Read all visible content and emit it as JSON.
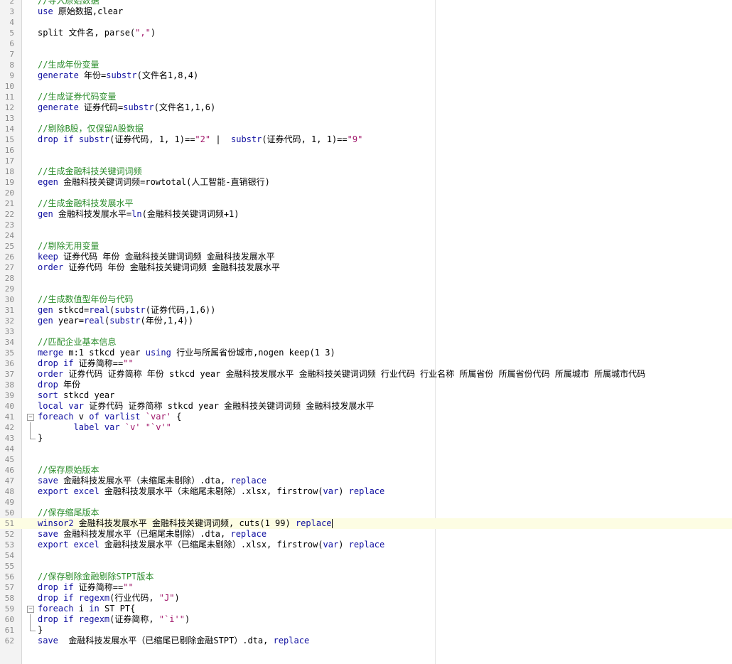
{
  "editor": {
    "language": "stata-do",
    "current_line": 51,
    "colors": {
      "keyword": "#1010a0",
      "comment": "#2a8c2a",
      "string": "#a0176a",
      "text": "#000000",
      "current_line_bg": "#fdfde3"
    },
    "lines": [
      {
        "n": "2",
        "tokens": [
          {
            "t": "c",
            "v": "//导入原始数据"
          }
        ]
      },
      {
        "n": "3",
        "tokens": [
          {
            "t": "k",
            "v": "use"
          },
          {
            "t": "p",
            "v": " 原始数据,clear"
          }
        ]
      },
      {
        "n": "4",
        "tokens": []
      },
      {
        "n": "5",
        "tokens": [
          {
            "t": "p",
            "v": "split 文件名, parse("
          },
          {
            "t": "s",
            "v": "\",\""
          },
          {
            "t": "p",
            "v": ")"
          }
        ]
      },
      {
        "n": "6",
        "tokens": []
      },
      {
        "n": "7",
        "tokens": []
      },
      {
        "n": "8",
        "tokens": [
          {
            "t": "c",
            "v": "//生成年份变量"
          }
        ]
      },
      {
        "n": "9",
        "tokens": [
          {
            "t": "k",
            "v": "generate"
          },
          {
            "t": "p",
            "v": " 年份="
          },
          {
            "t": "k",
            "v": "substr"
          },
          {
            "t": "p",
            "v": "(文件名1,8,4)"
          }
        ]
      },
      {
        "n": "10",
        "tokens": []
      },
      {
        "n": "11",
        "tokens": [
          {
            "t": "c",
            "v": "//生成证券代码变量"
          }
        ]
      },
      {
        "n": "12",
        "tokens": [
          {
            "t": "k",
            "v": "generate"
          },
          {
            "t": "p",
            "v": " 证券代码="
          },
          {
            "t": "k",
            "v": "substr"
          },
          {
            "t": "p",
            "v": "(文件名1,1,6)"
          }
        ]
      },
      {
        "n": "13",
        "tokens": []
      },
      {
        "n": "14",
        "tokens": [
          {
            "t": "c",
            "v": "//剔除B股，仅保留A股数据"
          }
        ]
      },
      {
        "n": "15",
        "tokens": [
          {
            "t": "k",
            "v": "drop if"
          },
          {
            "t": "p",
            "v": " "
          },
          {
            "t": "k",
            "v": "substr"
          },
          {
            "t": "p",
            "v": "(证券代码, 1, 1)=="
          },
          {
            "t": "s",
            "v": "\"2\""
          },
          {
            "t": "p",
            "v": " |  "
          },
          {
            "t": "k",
            "v": "substr"
          },
          {
            "t": "p",
            "v": "(证券代码, 1, 1)=="
          },
          {
            "t": "s",
            "v": "\"9\""
          }
        ]
      },
      {
        "n": "16",
        "tokens": []
      },
      {
        "n": "17",
        "tokens": []
      },
      {
        "n": "18",
        "tokens": [
          {
            "t": "c",
            "v": "//生成金融科技关键词词频"
          }
        ]
      },
      {
        "n": "19",
        "tokens": [
          {
            "t": "k",
            "v": "egen"
          },
          {
            "t": "p",
            "v": " 金融科技关键词词频=rowtotal(人工智能-直销银行)"
          }
        ]
      },
      {
        "n": "20",
        "tokens": []
      },
      {
        "n": "21",
        "tokens": [
          {
            "t": "c",
            "v": "//生成金融科技发展水平"
          }
        ]
      },
      {
        "n": "22",
        "tokens": [
          {
            "t": "k",
            "v": "gen"
          },
          {
            "t": "p",
            "v": " 金融科技发展水平="
          },
          {
            "t": "k",
            "v": "ln"
          },
          {
            "t": "p",
            "v": "(金融科技关键词词频+1)"
          }
        ]
      },
      {
        "n": "23",
        "tokens": []
      },
      {
        "n": "24",
        "tokens": []
      },
      {
        "n": "25",
        "tokens": [
          {
            "t": "c",
            "v": "//剔除无用变量"
          }
        ]
      },
      {
        "n": "26",
        "tokens": [
          {
            "t": "k",
            "v": "keep"
          },
          {
            "t": "p",
            "v": " 证券代码 年份 金融科技关键词词频 金融科技发展水平"
          }
        ]
      },
      {
        "n": "27",
        "tokens": [
          {
            "t": "k",
            "v": "order"
          },
          {
            "t": "p",
            "v": " 证券代码 年份 金融科技关键词词频 金融科技发展水平"
          }
        ]
      },
      {
        "n": "28",
        "tokens": []
      },
      {
        "n": "29",
        "tokens": []
      },
      {
        "n": "30",
        "tokens": [
          {
            "t": "c",
            "v": "//生成数值型年份与代码"
          }
        ]
      },
      {
        "n": "31",
        "tokens": [
          {
            "t": "k",
            "v": "gen"
          },
          {
            "t": "p",
            "v": " stkcd="
          },
          {
            "t": "k",
            "v": "real"
          },
          {
            "t": "p",
            "v": "("
          },
          {
            "t": "k",
            "v": "substr"
          },
          {
            "t": "p",
            "v": "(证券代码,1,6))"
          }
        ]
      },
      {
        "n": "32",
        "tokens": [
          {
            "t": "k",
            "v": "gen"
          },
          {
            "t": "p",
            "v": " year="
          },
          {
            "t": "k",
            "v": "real"
          },
          {
            "t": "p",
            "v": "("
          },
          {
            "t": "k",
            "v": "substr"
          },
          {
            "t": "p",
            "v": "(年份,1,4))"
          }
        ]
      },
      {
        "n": "33",
        "tokens": []
      },
      {
        "n": "34",
        "tokens": [
          {
            "t": "c",
            "v": "//匹配企业基本信息"
          }
        ]
      },
      {
        "n": "35",
        "tokens": [
          {
            "t": "k",
            "v": "merge"
          },
          {
            "t": "p",
            "v": " m:1 stkcd year "
          },
          {
            "t": "k",
            "v": "using"
          },
          {
            "t": "p",
            "v": " 行业与所属省份城市,nogen keep(1 3)"
          }
        ]
      },
      {
        "n": "36",
        "tokens": [
          {
            "t": "k",
            "v": "drop if"
          },
          {
            "t": "p",
            "v": " 证券简称=="
          },
          {
            "t": "s",
            "v": "\"\""
          }
        ]
      },
      {
        "n": "37",
        "tokens": [
          {
            "t": "k",
            "v": "order"
          },
          {
            "t": "p",
            "v": " 证券代码 证券简称 年份 stkcd year 金融科技发展水平 金融科技关键词词频 行业代码 行业名称 所属省份 所属省份代码 所属城市 所属城市代码"
          }
        ]
      },
      {
        "n": "38",
        "tokens": [
          {
            "t": "k",
            "v": "drop"
          },
          {
            "t": "p",
            "v": " 年份"
          }
        ]
      },
      {
        "n": "39",
        "tokens": [
          {
            "t": "k",
            "v": "sort"
          },
          {
            "t": "p",
            "v": " stkcd year"
          }
        ]
      },
      {
        "n": "40",
        "tokens": [
          {
            "t": "k",
            "v": "local var"
          },
          {
            "t": "p",
            "v": " 证券代码 证券简称 stkcd year 金融科技关键词词频 金融科技发展水平"
          }
        ]
      },
      {
        "n": "41",
        "fold": "open",
        "tokens": [
          {
            "t": "k",
            "v": "foreach"
          },
          {
            "t": "p",
            "v": " v "
          },
          {
            "t": "k",
            "v": "of varlist"
          },
          {
            "t": "p",
            "v": " "
          },
          {
            "t": "s",
            "v": "`var'"
          },
          {
            "t": "p",
            "v": " {"
          }
        ]
      },
      {
        "n": "42",
        "fold": "mid",
        "tokens": [
          {
            "t": "p",
            "v": "       "
          },
          {
            "t": "k",
            "v": "label var"
          },
          {
            "t": "p",
            "v": " "
          },
          {
            "t": "s",
            "v": "`v'"
          },
          {
            "t": "p",
            "v": " "
          },
          {
            "t": "s",
            "v": "\"`v'\""
          }
        ]
      },
      {
        "n": "43",
        "fold": "end",
        "tokens": [
          {
            "t": "p",
            "v": "}"
          }
        ]
      },
      {
        "n": "44",
        "tokens": []
      },
      {
        "n": "45",
        "tokens": []
      },
      {
        "n": "46",
        "tokens": [
          {
            "t": "c",
            "v": "//保存原始版本"
          }
        ]
      },
      {
        "n": "47",
        "tokens": [
          {
            "t": "k",
            "v": "save"
          },
          {
            "t": "p",
            "v": " 金融科技发展水平（未缩尾未剔除）.dta, "
          },
          {
            "t": "k",
            "v": "replace"
          }
        ]
      },
      {
        "n": "48",
        "tokens": [
          {
            "t": "k",
            "v": "export excel"
          },
          {
            "t": "p",
            "v": " 金融科技发展水平（未缩尾未剔除）.xlsx, firstrow("
          },
          {
            "t": "k",
            "v": "var"
          },
          {
            "t": "p",
            "v": ") "
          },
          {
            "t": "k",
            "v": "replace"
          }
        ]
      },
      {
        "n": "49",
        "tokens": []
      },
      {
        "n": "50",
        "tokens": [
          {
            "t": "c",
            "v": "//保存缩尾版本"
          }
        ]
      },
      {
        "n": "51",
        "tokens": [
          {
            "t": "k",
            "v": "winsor2"
          },
          {
            "t": "p",
            "v": " 金融科技发展水平 金融科技关键词词频, cuts(1 99) "
          },
          {
            "t": "k",
            "v": "replace"
          }
        ],
        "caret": true
      },
      {
        "n": "52",
        "tokens": [
          {
            "t": "k",
            "v": "save"
          },
          {
            "t": "p",
            "v": " 金融科技发展水平（已缩尾未剔除）.dta, "
          },
          {
            "t": "k",
            "v": "replace"
          }
        ]
      },
      {
        "n": "53",
        "tokens": [
          {
            "t": "k",
            "v": "export excel"
          },
          {
            "t": "p",
            "v": " 金融科技发展水平（已缩尾未剔除）.xlsx, firstrow("
          },
          {
            "t": "k",
            "v": "var"
          },
          {
            "t": "p",
            "v": ") "
          },
          {
            "t": "k",
            "v": "replace"
          }
        ]
      },
      {
        "n": "54",
        "tokens": []
      },
      {
        "n": "55",
        "tokens": []
      },
      {
        "n": "56",
        "tokens": [
          {
            "t": "c",
            "v": "//保存剔除金融剔除STPT版本"
          }
        ]
      },
      {
        "n": "57",
        "tokens": [
          {
            "t": "k",
            "v": "drop if"
          },
          {
            "t": "p",
            "v": " 证券简称=="
          },
          {
            "t": "s",
            "v": "\"\""
          }
        ]
      },
      {
        "n": "58",
        "tokens": [
          {
            "t": "k",
            "v": "drop if"
          },
          {
            "t": "p",
            "v": " "
          },
          {
            "t": "k",
            "v": "regexm"
          },
          {
            "t": "p",
            "v": "(行业代码, "
          },
          {
            "t": "s",
            "v": "\"J\""
          },
          {
            "t": "p",
            "v": ")"
          }
        ]
      },
      {
        "n": "59",
        "fold": "open",
        "tokens": [
          {
            "t": "k",
            "v": "foreach"
          },
          {
            "t": "p",
            "v": " i "
          },
          {
            "t": "k",
            "v": "in"
          },
          {
            "t": "p",
            "v": " ST PT{"
          }
        ]
      },
      {
        "n": "60",
        "fold": "mid",
        "tokens": [
          {
            "t": "k",
            "v": "drop if"
          },
          {
            "t": "p",
            "v": " "
          },
          {
            "t": "k",
            "v": "regexm"
          },
          {
            "t": "p",
            "v": "(证券简称, "
          },
          {
            "t": "s",
            "v": "\"`i'\""
          },
          {
            "t": "p",
            "v": ")"
          }
        ]
      },
      {
        "n": "61",
        "fold": "end",
        "tokens": [
          {
            "t": "p",
            "v": "}"
          }
        ]
      },
      {
        "n": "62",
        "tokens": [
          {
            "t": "k",
            "v": "save"
          },
          {
            "t": "p",
            "v": "  金融科技发展水平（已缩尾已剔除金融STPT）.dta, "
          },
          {
            "t": "k",
            "v": "replace"
          }
        ]
      }
    ]
  }
}
